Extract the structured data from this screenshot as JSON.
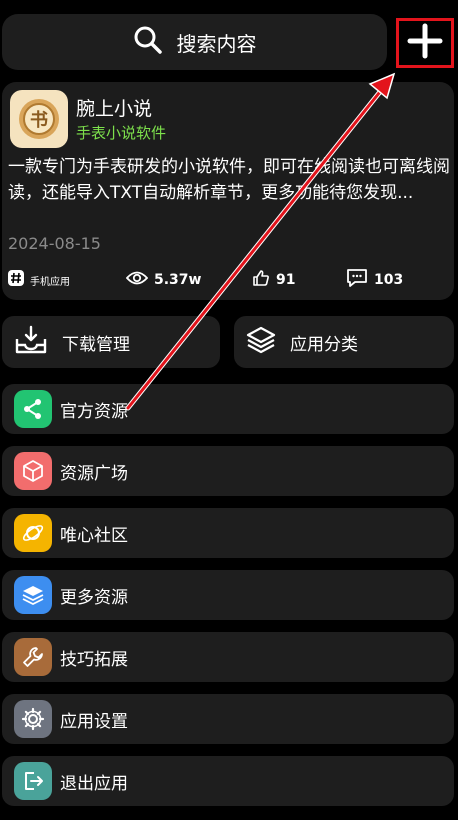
{
  "search": {
    "label": "搜索内容"
  },
  "app": {
    "name": "腕上小说",
    "icon_char": "书",
    "category": "手表小说软件",
    "description": "一款专门为手表研发的小说软件，即可在线阅读也可离线阅读，还能导入TXT自动解析章节，更多功能待您发现...",
    "date": "2024-08-15",
    "tag": "手机应用",
    "views": "5.37w",
    "likes": "91",
    "comments": "103"
  },
  "quick_actions": [
    {
      "label": "下载管理",
      "icon": "download-tray-icon"
    },
    {
      "label": "应用分类",
      "icon": "layers-icon"
    }
  ],
  "menu": [
    {
      "label": "官方资源",
      "icon": "share-icon",
      "color": "#22c472"
    },
    {
      "label": "资源广场",
      "icon": "cube-icon",
      "color": "#f26d6d"
    },
    {
      "label": "唯心社区",
      "icon": "planet-icon",
      "color": "#f5b400"
    },
    {
      "label": "更多资源",
      "icon": "stack-icon",
      "color": "#3d8ef0"
    },
    {
      "label": "技巧拓展",
      "icon": "wrench-icon",
      "color": "#a86b3a"
    },
    {
      "label": "应用设置",
      "icon": "gear-icon",
      "color": "#6e7480"
    },
    {
      "label": "退出应用",
      "icon": "exit-icon",
      "color": "#4aa39a"
    }
  ],
  "colors": {
    "accent_green": "#7de04c",
    "annotation_red": "#e3141c"
  }
}
